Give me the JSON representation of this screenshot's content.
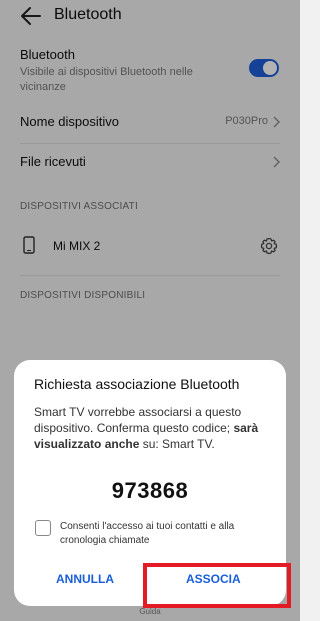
{
  "header": {
    "title": "Bluetooth",
    "back_icon": "arrow-left-icon"
  },
  "bluetooth": {
    "title": "Bluetooth",
    "subtitle": "Visibile ai dispositivi Bluetooth nelle vicinanze",
    "enabled": true,
    "accent": "#1f5fd8"
  },
  "device_name": {
    "label": "Nome dispositivo",
    "value": "P030Pro"
  },
  "received_files": {
    "label": "File ricevuti"
  },
  "paired": {
    "heading": "DISPOSITIVI ASSOCIATI",
    "devices": [
      {
        "name": "Mi MIX 2",
        "icon": "phone-icon",
        "settings_icon": "gear-icon"
      }
    ]
  },
  "available": {
    "heading": "DISPOSITIVI DISPONIBILI"
  },
  "footer": {
    "help": "Guida"
  },
  "dialog": {
    "title": "Richiesta associazione Bluetooth",
    "message_part1": "Smart TV vorrebbe associarsi a questo dispositivo. Conferma questo codice; ",
    "message_bold": "sarà visualizzato anche",
    "message_part2": "  su: Smart TV.",
    "code": "973868",
    "checkbox_label": "Consenti l'accesso ai tuoi contatti e alla cronologia chiamate",
    "checkbox_checked": false,
    "cancel_label": "ANNULLA",
    "confirm_label": "ASSOCIA",
    "highlight_color": "#e31b25"
  }
}
